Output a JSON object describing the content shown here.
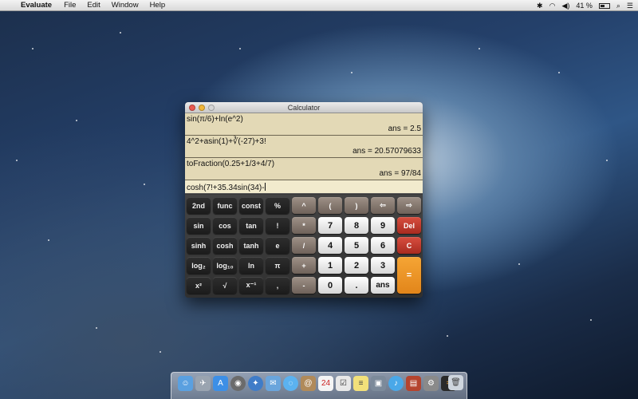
{
  "menubar": {
    "app_name": "Evaluate",
    "items": [
      "File",
      "Edit",
      "Window",
      "Help"
    ],
    "battery": "41 %"
  },
  "window": {
    "title": "Calculator",
    "history": [
      {
        "expr": "sin(π/6)+ln(e^2)",
        "ans": "ans = 2.5"
      },
      {
        "expr": "4^2+asin(1)+∛(-27)+3!",
        "ans": "ans = 20.57079633"
      },
      {
        "expr": "toFraction(0.25+1/3+4/7)",
        "ans": "ans = 97/84"
      }
    ],
    "input": "cosh(7!+35.34sin(34)-"
  },
  "keypad": {
    "row1": [
      "2nd",
      "func",
      "const",
      "%",
      "^",
      "(",
      ")",
      "⇦",
      "⇨"
    ],
    "row2": [
      "sin",
      "cos",
      "tan",
      "!",
      "*",
      "7",
      "8",
      "9",
      "Del"
    ],
    "row3": [
      "sinh",
      "cosh",
      "tanh",
      "e",
      "/",
      "4",
      "5",
      "6",
      "C"
    ],
    "row4": [
      "log₂",
      "log₁₀",
      "ln",
      "π",
      "+",
      "1",
      "2",
      "3"
    ],
    "row5": [
      "x²",
      "√",
      "x⁻¹",
      ",",
      "-",
      "0",
      ".",
      "ans"
    ],
    "equals": "="
  },
  "colors": {
    "history_bg": "#e3d9b6",
    "input_bg": "#f2ebcd",
    "del_red": "#c0392b",
    "equals_orange": "#ee9a2a"
  }
}
